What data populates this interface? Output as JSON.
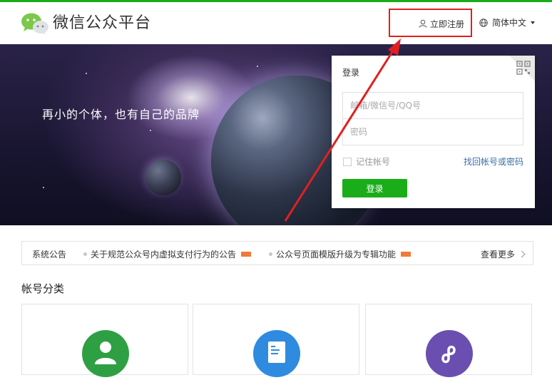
{
  "header": {
    "brand": "微信公众平台",
    "register": "立即注册",
    "language": "简体中文"
  },
  "banner": {
    "slogan": "再小的个体，也有自己的品牌"
  },
  "login": {
    "title": "登录",
    "username_placeholder": "邮箱/微信号/QQ号",
    "password_placeholder": "密码",
    "remember_label": "记住帐号",
    "forgot_link": "找回帐号或密码",
    "submit": "登录"
  },
  "notice": {
    "label": "系统公告",
    "items": [
      "关于规范公众号内虚拟支付行为的公告",
      "公众号页面模版升级为专辑功能"
    ],
    "more": "查看更多"
  },
  "accounts": {
    "title": "帐号分类",
    "cards": [
      {
        "icon": "person-icon",
        "color": "#2ea043"
      },
      {
        "icon": "document-icon",
        "color": "#2f8be0"
      },
      {
        "icon": "mini-program-icon",
        "color": "#6a4fb0"
      }
    ]
  },
  "colors": {
    "brand_green": "#1AAD19",
    "annotation_red": "#e02020",
    "link_blue": "#3a6ea5"
  }
}
